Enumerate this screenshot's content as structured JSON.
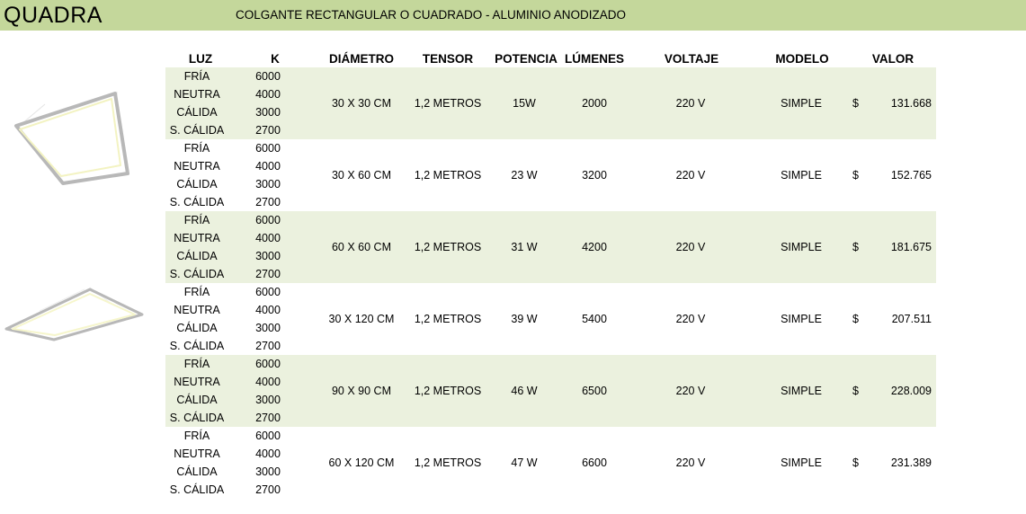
{
  "header": {
    "brand": "QUADRA",
    "subtitle": "COLGANTE RECTANGULAR O CUADRADO - ALUMINIO ANODIZADO",
    "background": "#c4d79b"
  },
  "images": [
    {
      "icon": "square-pendant-lamp-image"
    },
    {
      "icon": "rectangular-pendant-lamp-image"
    }
  ],
  "columns": {
    "luz": "LUZ",
    "k": "K",
    "diametro": "DIÁMETRO",
    "tensor": "TENSOR",
    "potencia": "POTENCIA",
    "lumenes": "LÚMENES",
    "voltaje": "VOLTAJE",
    "modelo": "MODELO",
    "valor": "VALOR"
  },
  "colors": {
    "row_shade": "#ebf1de"
  },
  "products": [
    {
      "lights": [
        {
          "luz": "FRÍA",
          "k": "6000"
        },
        {
          "luz": "NEUTRA",
          "k": "4000"
        },
        {
          "luz": "CÁLIDA",
          "k": "3000"
        },
        {
          "luz": "S. CÁLIDA",
          "k": "2700"
        }
      ],
      "diametro": "30 X 30 CM",
      "tensor": "1,2 METROS",
      "potencia": "15W",
      "lumenes": "2000",
      "voltaje": "220 V",
      "modelo": "SIMPLE",
      "currency": "$",
      "valor": "131.668"
    },
    {
      "lights": [
        {
          "luz": "FRÍA",
          "k": "6000"
        },
        {
          "luz": "NEUTRA",
          "k": "4000"
        },
        {
          "luz": "CÁLIDA",
          "k": "3000"
        },
        {
          "luz": "S. CÁLIDA",
          "k": "2700"
        }
      ],
      "diametro": "30 X 60 CM",
      "tensor": "1,2 METROS",
      "potencia": "23 W",
      "lumenes": "3200",
      "voltaje": "220 V",
      "modelo": "SIMPLE",
      "currency": "$",
      "valor": "152.765"
    },
    {
      "lights": [
        {
          "luz": "FRÍA",
          "k": "6000"
        },
        {
          "luz": "NEUTRA",
          "k": "4000"
        },
        {
          "luz": "CÁLIDA",
          "k": "3000"
        },
        {
          "luz": "S. CÁLIDA",
          "k": "2700"
        }
      ],
      "diametro": "60 X 60 CM",
      "tensor": "1,2 METROS",
      "potencia": "31 W",
      "lumenes": "4200",
      "voltaje": "220 V",
      "modelo": "SIMPLE",
      "currency": "$",
      "valor": "181.675"
    },
    {
      "lights": [
        {
          "luz": "FRÍA",
          "k": "6000"
        },
        {
          "luz": "NEUTRA",
          "k": "4000"
        },
        {
          "luz": "CÁLIDA",
          "k": "3000"
        },
        {
          "luz": "S. CÁLIDA",
          "k": "2700"
        }
      ],
      "diametro": "30 X 120 CM",
      "tensor": "1,2 METROS",
      "potencia": "39 W",
      "lumenes": "5400",
      "voltaje": "220 V",
      "modelo": "SIMPLE",
      "currency": "$",
      "valor": "207.511"
    },
    {
      "lights": [
        {
          "luz": "FRÍA",
          "k": "6000"
        },
        {
          "luz": "NEUTRA",
          "k": "4000"
        },
        {
          "luz": "CÁLIDA",
          "k": "3000"
        },
        {
          "luz": "S. CÁLIDA",
          "k": "2700"
        }
      ],
      "diametro": "90 X 90 CM",
      "tensor": "1,2 METROS",
      "potencia": "46 W",
      "lumenes": "6500",
      "voltaje": "220 V",
      "modelo": "SIMPLE",
      "currency": "$",
      "valor": "228.009"
    },
    {
      "lights": [
        {
          "luz": "FRÍA",
          "k": "6000"
        },
        {
          "luz": "NEUTRA",
          "k": "4000"
        },
        {
          "luz": "CÁLIDA",
          "k": "3000"
        },
        {
          "luz": "S. CÁLIDA",
          "k": "2700"
        }
      ],
      "diametro": "60 X 120 CM",
      "tensor": "1,2 METROS",
      "potencia": "47 W",
      "lumenes": "6600",
      "voltaje": "220 V",
      "modelo": "SIMPLE",
      "currency": "$",
      "valor": "231.389"
    }
  ]
}
